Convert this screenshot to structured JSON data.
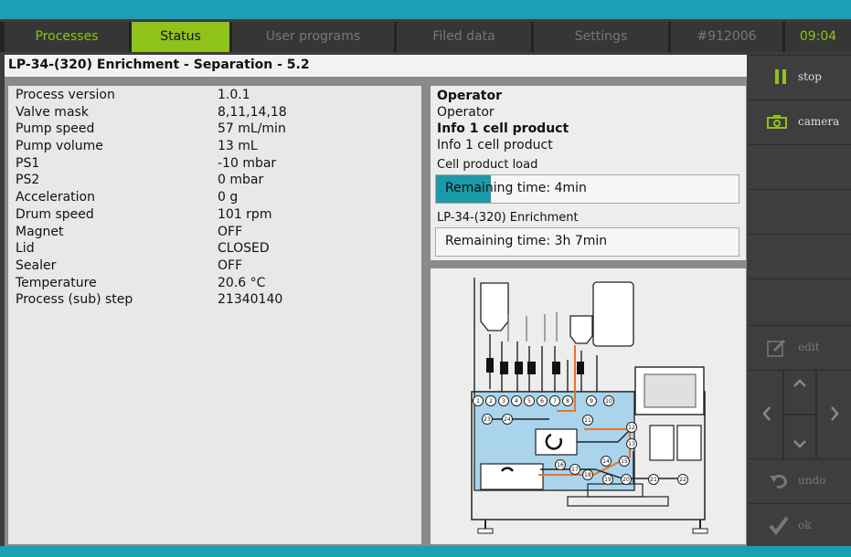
{
  "tabs": [
    {
      "label": "Processes"
    },
    {
      "label": "Status"
    },
    {
      "label": "User programs"
    },
    {
      "label": "Filed data"
    },
    {
      "label": "Settings"
    },
    {
      "label": "#912006"
    },
    {
      "label": "09:04"
    }
  ],
  "title": "LP-34-(320) Enrichment - Separation - 5.2",
  "params": [
    {
      "key": "Process version",
      "value": "1.0.1"
    },
    {
      "key": "Valve mask",
      "value": "8,11,14,18"
    },
    {
      "key": "Pump speed",
      "value": "57 mL/min"
    },
    {
      "key": "Pump volume",
      "value": "13 mL"
    },
    {
      "key": "PS1",
      "value": "-10 mbar"
    },
    {
      "key": "PS2",
      "value": "0 mbar"
    },
    {
      "key": "Acceleration",
      "value": "0 g"
    },
    {
      "key": "Drum speed",
      "value": "101 rpm"
    },
    {
      "key": "Magnet",
      "value": "OFF"
    },
    {
      "key": "Lid",
      "value": "CLOSED"
    },
    {
      "key": "Sealer",
      "value": "OFF"
    },
    {
      "key": "Temperature",
      "value": "20.6 °C"
    },
    {
      "key": "Process (sub) step",
      "value": "21340140"
    }
  ],
  "info": {
    "operator_heading": "Operator",
    "operator_value": "Operator",
    "cell_heading": "Info 1 cell product",
    "cell_value": "Info 1 cell product",
    "load_label": "Cell product load",
    "load_remaining": "Remaining time: 4min",
    "load_progress": 0.18,
    "enrich_label": "LP-34-(320) Enrichment",
    "enrich_remaining": "Remaining time: 3h 7min"
  },
  "sidebar": {
    "stop_label": "stop",
    "camera_label": "camera",
    "edit_label": "edit",
    "undo_label": "undo",
    "ok_label": "ok"
  },
  "diagram": {
    "ports": [
      "1",
      "2",
      "3",
      "4",
      "5",
      "6",
      "7",
      "8",
      "9",
      "10",
      "11",
      "12",
      "13",
      "14",
      "15",
      "16",
      "17",
      "18",
      "19",
      "20",
      "21",
      "22",
      "23",
      "24"
    ]
  },
  "colors": {
    "accent": "#8fc21a",
    "teal": "#1aa0b4",
    "tube_orange": "#e8742a",
    "chamber_blue": "#a9d4ec"
  },
  "icons": [
    "pause-icon",
    "camera-icon",
    "edit-icon",
    "arrow-up-icon",
    "arrow-down-icon",
    "arrow-left-icon",
    "arrow-right-icon",
    "undo-icon",
    "check-icon"
  ]
}
